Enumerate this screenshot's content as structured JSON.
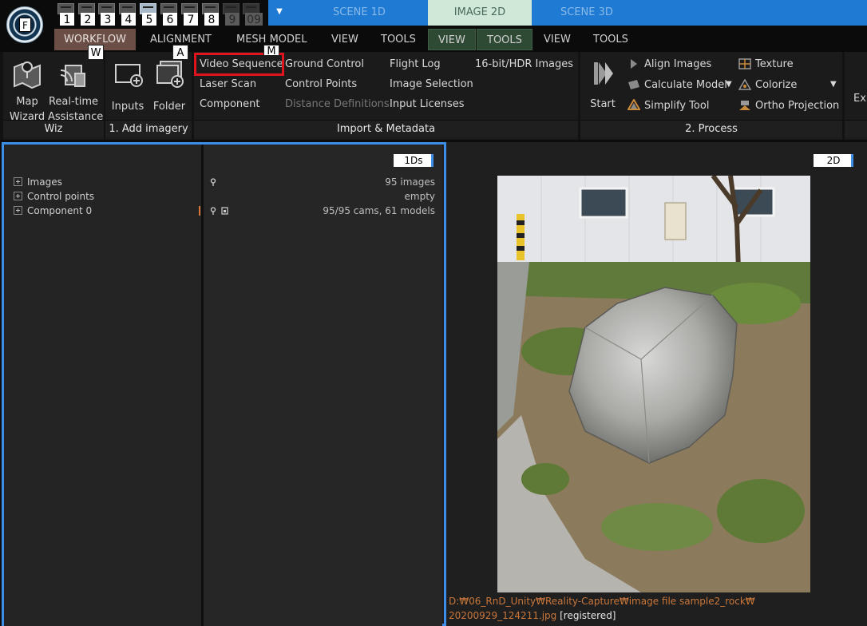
{
  "app": {
    "logo_letter": "F"
  },
  "layout_tabs": [
    "1",
    "2",
    "3",
    "4",
    "5",
    "6",
    "7",
    "8",
    "9",
    "09"
  ],
  "scene_tabs": {
    "scene_1d": "SCENE 1D",
    "image_2d": "IMAGE 2D",
    "scene_3d": "SCENE 3D"
  },
  "menus": {
    "workflow": "WORKFLOW",
    "alignment": "ALIGNMENT",
    "mesh_model": "MESH MODEL",
    "view1": "VIEW",
    "tools1": "TOOLS",
    "view2": "VIEW",
    "tools2": "TOOLS",
    "view3": "VIEW",
    "tools3": "TOOLS"
  },
  "keytips": {
    "workflow": "W",
    "folder": "A",
    "video_sequence": "M"
  },
  "ribbon": {
    "wiz": {
      "map_wizard_1": "Map",
      "map_wizard_2": "Wizard",
      "realtime_1": "Real-time",
      "realtime_2": "Assistance",
      "footer": "Wiz"
    },
    "add_imagery": {
      "inputs": "Inputs",
      "folder": "Folder",
      "footer": "1. Add imagery"
    },
    "import_metadata": {
      "video_sequence": "Video Sequence",
      "laser_scan": "Laser Scan",
      "component": "Component",
      "ground_control": "Ground Control",
      "control_points": "Control Points",
      "distance_definitions": "Distance Definitions",
      "flight_log": "Flight Log",
      "image_selection": "Image Selection",
      "input_licenses": "Input Licenses",
      "hdr_images": "16-bit/HDR Images",
      "footer": "Import & Metadata"
    },
    "process": {
      "start": "Start",
      "align_images": "Align Images",
      "calculate_model": "Calculate Model",
      "simplify_tool": "Simplify Tool",
      "texture": "Texture",
      "colorize": "Colorize",
      "ortho_projection": "Ortho Projection",
      "footer": "2. Process"
    },
    "export_partial": "Exp"
  },
  "left_panel": {
    "badge": "1Ds",
    "tree": [
      {
        "label": "Images",
        "value": "95 images"
      },
      {
        "label": "Control points",
        "value": "empty"
      },
      {
        "label": "Component 0",
        "value": "95/95 cams, 61 models"
      }
    ]
  },
  "right_panel": {
    "badge": "2D",
    "path_line1": "D:₩06_RnD_Unity₩Reality-Capture₩image file sample2_rock₩",
    "path_line2": "20200929_124211.jpg",
    "status": "[registered]"
  },
  "colors": {
    "accent_blue": "#1e7ad2",
    "panel_border": "#3d8ee8",
    "highlight_red": "#e0141e",
    "path_orange": "#c9773b"
  }
}
